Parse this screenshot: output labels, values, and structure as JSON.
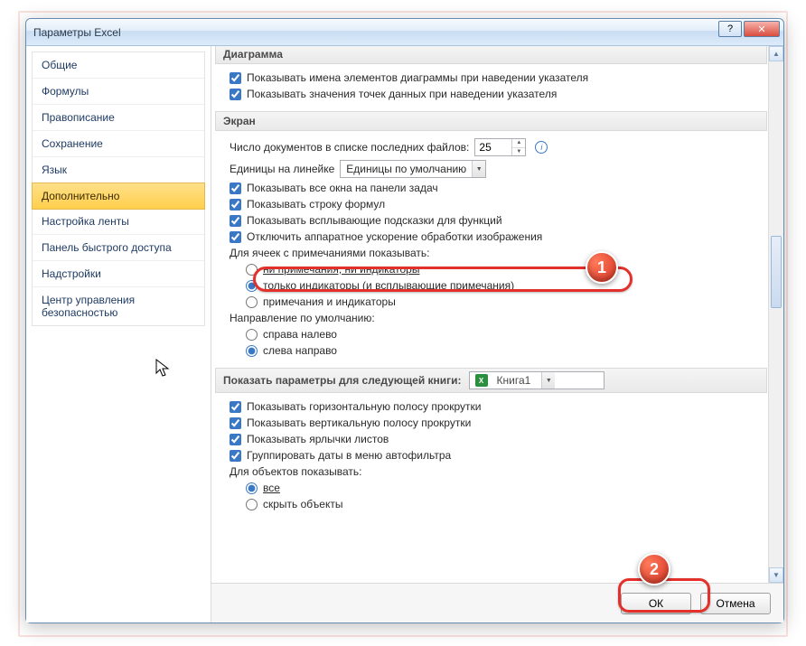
{
  "window": {
    "title": "Параметры Excel"
  },
  "sidebar": {
    "items": [
      {
        "label": "Общие"
      },
      {
        "label": "Формулы"
      },
      {
        "label": "Правописание"
      },
      {
        "label": "Сохранение"
      },
      {
        "label": "Язык"
      },
      {
        "label": "Дополнительно"
      },
      {
        "label": "Настройка ленты"
      },
      {
        "label": "Панель быстрого доступа"
      },
      {
        "label": "Надстройки"
      },
      {
        "label": "Центр управления безопасностью"
      }
    ],
    "active_index": 5
  },
  "sections": {
    "chart": {
      "head": "Диаграмма",
      "opt1": "Показывать имена элементов диаграммы при наведении указателя",
      "opt2": "Показывать значения точек данных при наведении указателя"
    },
    "screen": {
      "head": "Экран",
      "recent_label": "Число документов в списке последних файлов:",
      "recent_value": "25",
      "ruler_label": "Единицы на линейке",
      "ruler_value": "Единицы по умолчанию",
      "opt_allwin": "Показывать все окна на панели задач",
      "opt_formula": "Показывать строку формул",
      "opt_tooltips": "Показывать всплывающие подсказки для функций",
      "opt_hwaccel": "Отключить аппаратное ускорение обработки изображения",
      "comments_label": "Для ячеек с примечаниями показывать:",
      "c1": "ни примечания, ни индикаторы",
      "c2": "только индикаторы (и всплывающие примечания)",
      "c3": "примечания и индикаторы",
      "direction_label": "Направление по умолчанию:",
      "d1": "справа налево",
      "d2": "слева направо"
    },
    "workbook": {
      "head": "Показать параметры для следующей книги:",
      "book_name": "Книга1",
      "opt_hscroll": "Показывать горизонтальную полосу прокрутки",
      "opt_vscroll": "Показывать вертикальную полосу прокрутки",
      "opt_tabs": "Показывать ярлычки листов",
      "opt_group": "Группировать даты в меню автофильтра",
      "objects_label": "Для объектов показывать:",
      "o1": "все",
      "o2": "скрыть объекты"
    }
  },
  "footer": {
    "ok": "ОК",
    "cancel": "Отмена"
  },
  "badges": {
    "b1": "1",
    "b2": "2"
  }
}
